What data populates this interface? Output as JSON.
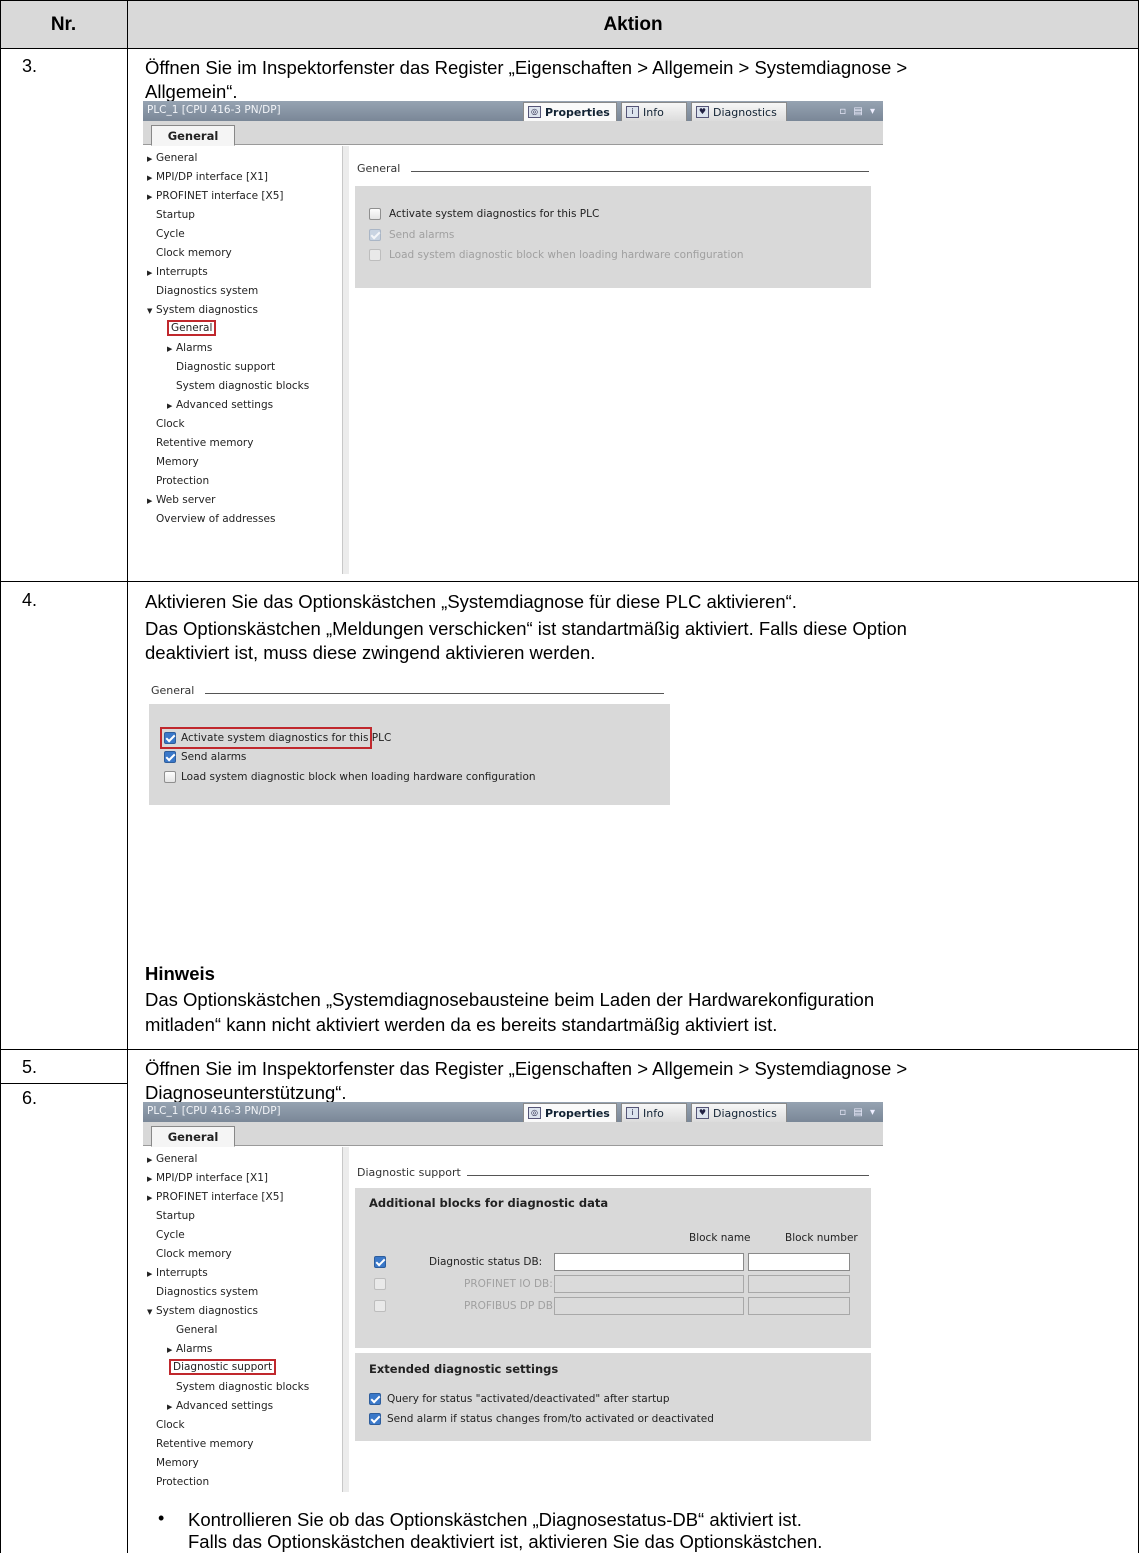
{
  "table": {
    "header": {
      "nr": "Nr.",
      "aktion": "Aktion"
    },
    "step3": {
      "nr": "3.",
      "line1": "Öffnen Sie im Inspektorfenster das Register „Eigenschaften > Allgemein > Systemdiagnose >",
      "line2": "Allgemein“."
    },
    "step4": {
      "nr": "4.",
      "line1": "Aktivieren Sie das Optionskästchen „Systemdiagnose für diese PLC aktivieren“.",
      "line2": "Das Optionskästchen „Meldungen verschicken“ ist standartmäßig aktiviert. Falls diese Option",
      "line3": "deaktiviert ist, muss diese zwingend aktivieren werden.",
      "note_title": "Hinweis",
      "note_line1": "Das Optionskästchen „Systemdiagnosebausteine beim Laden der Hardwarekonfiguration",
      "note_line2": "mitladen“ kann nicht aktiviert werden da es bereits standartmäßig aktiviert ist."
    },
    "step5": {
      "nr": "5.",
      "nr2": "6.",
      "line1": "Öffnen Sie im Inspektorfenster das Register „Eigenschaften > Allgemein > Systemdiagnose >",
      "line2": "Diagnoseunterstützung“.",
      "bullet": "•",
      "bullet_line1": "Kontrollieren Sie ob das Optionskästchen „Diagnosestatus-DB“ aktiviert ist.",
      "bullet_line2": "Falls das Optionskästchen deaktiviert ist, aktivieren Sie das Optionskästchen."
    }
  },
  "inspector": {
    "title": "PLC_1 [CPU 416-3 PN/DP]",
    "tabs": {
      "properties": "Properties",
      "info": "Info",
      "diagnostics": "Diagnostics"
    },
    "window_buttons": "▫ ▤ ▾",
    "general_tab": "General",
    "nav": {
      "general": "General",
      "mpi": "MPI/DP interface [X1]",
      "profinet": "PROFINET interface [X5]",
      "startup": "Startup",
      "cycle": "Cycle",
      "clock_memory": "Clock memory",
      "interrupts": "Interrupts",
      "diag_system": "Diagnostics system",
      "sys_diag": "System diagnostics",
      "sd_general": "General",
      "sd_alarms": "Alarms",
      "sd_support": "Diagnostic support",
      "sd_blocks": "System diagnostic blocks",
      "sd_advanced": "Advanced settings",
      "clock": "Clock",
      "retentive": "Retentive memory",
      "memory": "Memory",
      "protection": "Protection",
      "web": "Web server",
      "overview": "Overview of addresses"
    }
  },
  "general_section": {
    "title": "General",
    "activate": "Activate system diagnostics for this PLC",
    "send_alarms": "Send alarms",
    "load_block": "Load system diagnostic block when loading hardware configuration"
  },
  "diag_support": {
    "title": "Diagnostic support",
    "additional_title": "Additional blocks for diagnostic data",
    "col_block_name": "Block name",
    "col_block_number": "Block number",
    "status_db": "Diagnostic status DB:",
    "profinet_db": "PROFINET IO DB:",
    "profibus_db": "PROFIBUS DP DB:",
    "extended_title": "Extended diagnostic settings",
    "query_status": "Query for status \"activated/deactivated\" after startup",
    "send_alarm_change": "Send alarm if status changes from/to activated or deactivated"
  }
}
